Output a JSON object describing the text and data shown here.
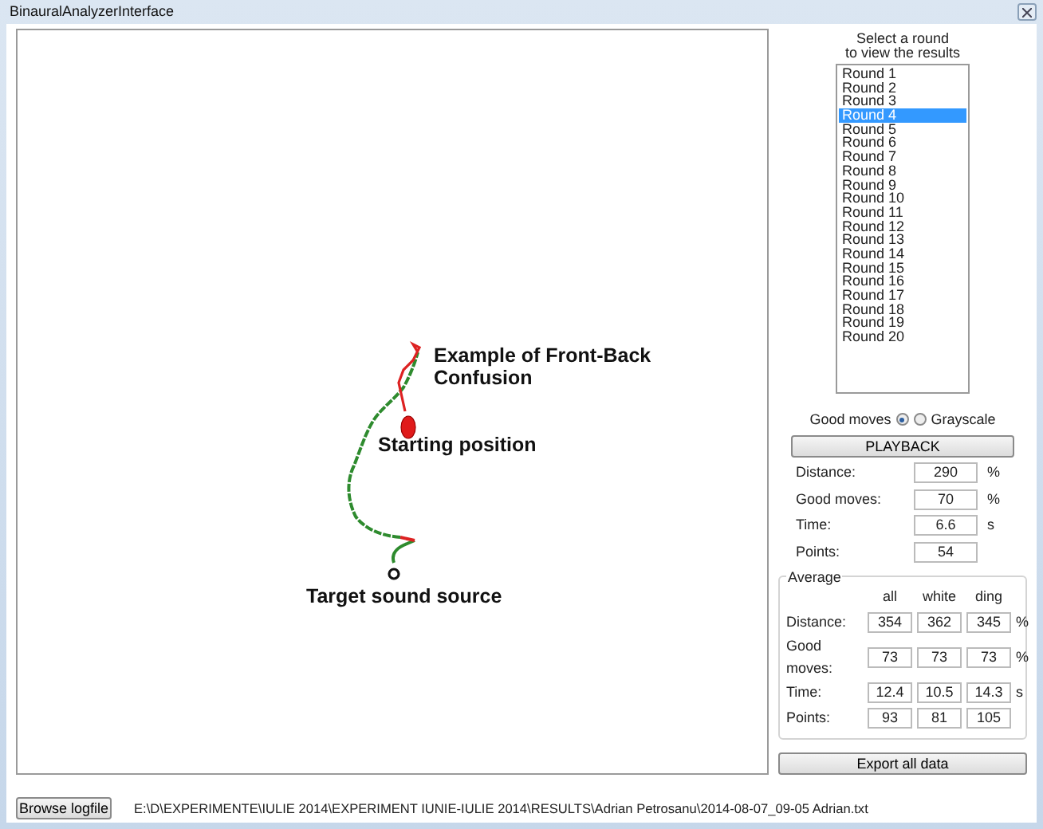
{
  "window": {
    "title": "BinauralAnalyzerInterface"
  },
  "canvas": {
    "labels": [
      {
        "text": "Example of Front-Back\nConfusion"
      },
      {
        "text": "Starting position"
      },
      {
        "text": "Target sound source"
      }
    ]
  },
  "rounds": {
    "caption": "Select a round\nto view the results",
    "items": [
      {
        "label": "Round 1",
        "selected": false
      },
      {
        "label": "Round 2",
        "selected": false
      },
      {
        "label": "Round 3",
        "selected": false
      },
      {
        "label": "Round 4",
        "selected": true
      },
      {
        "label": "Round 5",
        "selected": false
      },
      {
        "label": "Round 6",
        "selected": false
      },
      {
        "label": "Round 7",
        "selected": false
      },
      {
        "label": "Round 8",
        "selected": false
      },
      {
        "label": "Round 9",
        "selected": false
      },
      {
        "label": "Round 10",
        "selected": false
      },
      {
        "label": "Round 11",
        "selected": false
      },
      {
        "label": "Round 12",
        "selected": false
      },
      {
        "label": "Round 13",
        "selected": false
      },
      {
        "label": "Round 14",
        "selected": false
      },
      {
        "label": "Round 15",
        "selected": false
      },
      {
        "label": "Round 16",
        "selected": false
      },
      {
        "label": "Round 17",
        "selected": false
      },
      {
        "label": "Round 18",
        "selected": false
      },
      {
        "label": "Round 19",
        "selected": false
      },
      {
        "label": "Round 20",
        "selected": false
      }
    ]
  },
  "view_mode": [
    {
      "label": "Good moves",
      "selected": true
    },
    {
      "label": "Grayscale",
      "selected": false
    }
  ],
  "playback_button": "PLAYBACK",
  "results": [
    {
      "label": "Distance:",
      "value": "290",
      "unit": "%"
    },
    {
      "label": "Good moves:",
      "value": "70",
      "unit": "%"
    },
    {
      "label": "Time:",
      "value": "6.6",
      "unit": "s"
    },
    {
      "label": "Points:",
      "value": "54"
    }
  ],
  "average": {
    "title": "Average",
    "columns": [
      "all",
      "white",
      "ding"
    ],
    "rows": [
      {
        "label": "Distance:",
        "values": [
          "354",
          "362",
          "345"
        ],
        "unit": "%"
      },
      {
        "label": "Good moves:",
        "values": [
          "73",
          "73",
          "73"
        ],
        "unit": "%"
      },
      {
        "label": "Time:",
        "values": [
          "12.4",
          "10.5",
          "14.3"
        ],
        "unit": "s"
      },
      {
        "label": "Points:",
        "values": [
          "93",
          "81",
          "105"
        ]
      }
    ]
  },
  "export_button": "Export all data",
  "browse_button": "Browse logfile",
  "logfile_path": "E:\\D\\EXPERIMENTE\\IULIE 2014\\EXPERIMENT IUNIE-IULIE 2014\\RESULTS\\Adrian Petrosanu\\2014-08-07_09-05 Adrian.txt"
}
